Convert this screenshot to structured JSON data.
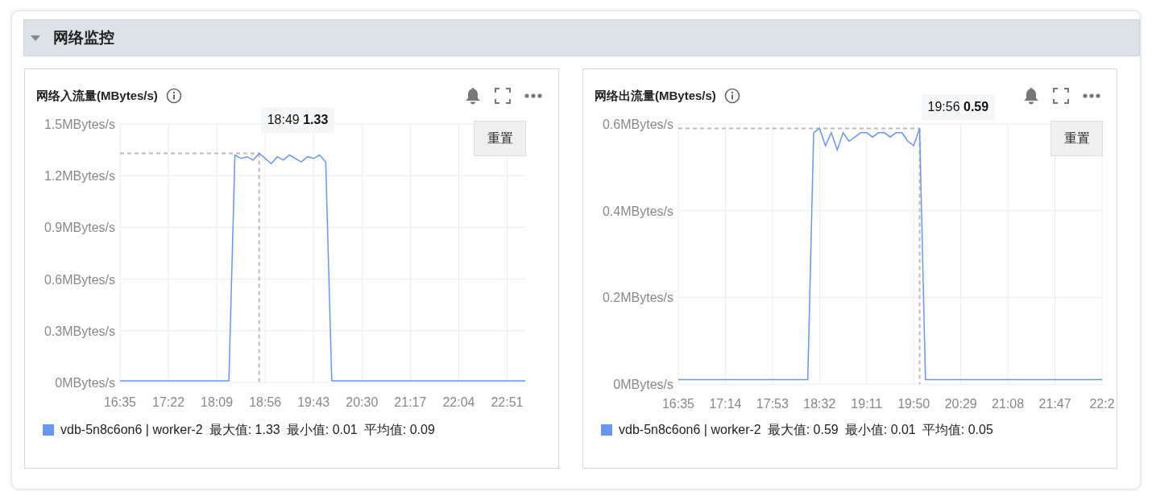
{
  "section": {
    "title": "网络监控",
    "expanded": true
  },
  "panels": [
    {
      "title": "网络入流量(MBytes/s)",
      "reset_button": "重置",
      "legend": {
        "stats": [
          "最大值: 1.33",
          "最小值: 0.01",
          "平均值: 0.09"
        ]
      },
      "chart_data": {
        "type": "line",
        "categories": [
          "16:35",
          null,
          null,
          null,
          null,
          null,
          null,
          null,
          "17:22",
          null,
          null,
          null,
          null,
          null,
          null,
          null,
          "18:09",
          null,
          null,
          null,
          null,
          null,
          null,
          null,
          "18:56",
          null,
          null,
          null,
          null,
          null,
          null,
          null,
          "19:43",
          null,
          null,
          null,
          null,
          null,
          null,
          null,
          "20:30",
          null,
          null,
          null,
          null,
          null,
          null,
          null,
          "21:17",
          null,
          null,
          null,
          null,
          null,
          null,
          null,
          "22:04",
          null,
          null,
          null,
          null,
          null,
          null,
          null,
          "22:51",
          null,
          null,
          null
        ],
        "series": [
          {
            "name": "vdb-5n8c6on6 | worker-2",
            "color": "#6797f2",
            "values": [
              0.01,
              0.01,
              0.01,
              0.01,
              0.01,
              0.01,
              0.01,
              0.01,
              0.01,
              0.01,
              0.01,
              0.01,
              0.01,
              0.01,
              0.01,
              0.01,
              0.01,
              0.01,
              0.01,
              1.32,
              1.3,
              1.31,
              1.29,
              1.33,
              1.3,
              1.27,
              1.31,
              1.29,
              1.32,
              1.3,
              1.28,
              1.31,
              1.3,
              1.32,
              1.28,
              0.01,
              0.01,
              0.01,
              0.01,
              0.01,
              0.01,
              0.01,
              0.01,
              0.01,
              0.01,
              0.01,
              0.01,
              0.01,
              0.01,
              0.01,
              0.01,
              0.01,
              0.01,
              0.01,
              0.01,
              0.01,
              0.01,
              0.01,
              0.01,
              0.01,
              0.01,
              0.01,
              0.01,
              0.01,
              0.01,
              0.01,
              0.01,
              0.01
            ]
          }
        ],
        "ylim": [
          0,
          1.5
        ],
        "grid": true,
        "ref_lines": [
          {
            "axis": "y",
            "value": 1.33
          }
        ],
        "yticks": [
          {
            "value": 0,
            "label": "0MBytes/s"
          },
          {
            "value": 0.3,
            "label": "0.3MBytes/s"
          },
          {
            "value": 0.6,
            "label": "0.6MBytes/s"
          },
          {
            "value": 0.9,
            "label": "0.9MBytes/s"
          },
          {
            "value": 1.2,
            "label": "1.2MBytes/s"
          },
          {
            "value": 1.5,
            "label": "1.5MBytes/s"
          }
        ],
        "annotations": [
          "18:49 **1.33**"
        ]
      }
    },
    {
      "title": "网络出流量(MBytes/s)",
      "reset_button": "重置",
      "legend": {
        "stats": [
          "最大值: 0.59",
          "最小值: 0.01",
          "平均值: 0.05"
        ]
      },
      "chart_data": {
        "type": "line",
        "categories": [
          "16:35",
          null,
          null,
          null,
          null,
          null,
          null,
          null,
          "17:14",
          null,
          null,
          null,
          null,
          null,
          null,
          null,
          "17:53",
          null,
          null,
          null,
          null,
          null,
          null,
          null,
          "18:32",
          null,
          null,
          null,
          null,
          null,
          null,
          null,
          "19:11",
          null,
          null,
          null,
          null,
          null,
          null,
          null,
          "19:50",
          null,
          null,
          null,
          null,
          null,
          null,
          null,
          "20:29",
          null,
          null,
          null,
          null,
          null,
          null,
          null,
          "21:08",
          null,
          null,
          null,
          null,
          null,
          null,
          null,
          "21:47",
          null,
          null,
          null,
          null,
          null,
          null,
          null,
          "22:2"
        ],
        "series": [
          {
            "name": "vdb-5n8c6on6 | worker-2",
            "color": "#6797f2",
            "values": [
              0.01,
              0.01,
              0.01,
              0.01,
              0.01,
              0.01,
              0.01,
              0.01,
              0.01,
              0.01,
              0.01,
              0.01,
              0.01,
              0.01,
              0.01,
              0.01,
              0.01,
              0.01,
              0.01,
              0.01,
              0.01,
              0.01,
              0.01,
              0.58,
              0.59,
              0.55,
              0.58,
              0.54,
              0.58,
              0.56,
              0.57,
              0.58,
              0.58,
              0.57,
              0.58,
              0.58,
              0.57,
              0.58,
              0.58,
              0.56,
              0.55,
              0.59,
              0.01,
              0.01,
              0.01,
              0.01,
              0.01,
              0.01,
              0.01,
              0.01,
              0.01,
              0.01,
              0.01,
              0.01,
              0.01,
              0.01,
              0.01,
              0.01,
              0.01,
              0.01,
              0.01,
              0.01,
              0.01,
              0.01,
              0.01,
              0.01,
              0.01,
              0.01,
              0.01,
              0.01,
              0.01,
              0.01,
              0.01
            ]
          }
        ],
        "ylim": [
          0,
          0.6
        ],
        "grid": true,
        "ref_lines": [
          {
            "axis": "y",
            "value": 0.59
          }
        ],
        "yticks": [
          {
            "value": 0,
            "label": "0MBytes/s"
          },
          {
            "value": 0.2,
            "label": "0.2MBytes/s"
          },
          {
            "value": 0.4,
            "label": "0.4MBytes/s"
          },
          {
            "value": 0.6,
            "label": "0.6MBytes/s"
          }
        ],
        "annotations": [
          "19:56 **0.59**"
        ]
      }
    }
  ]
}
